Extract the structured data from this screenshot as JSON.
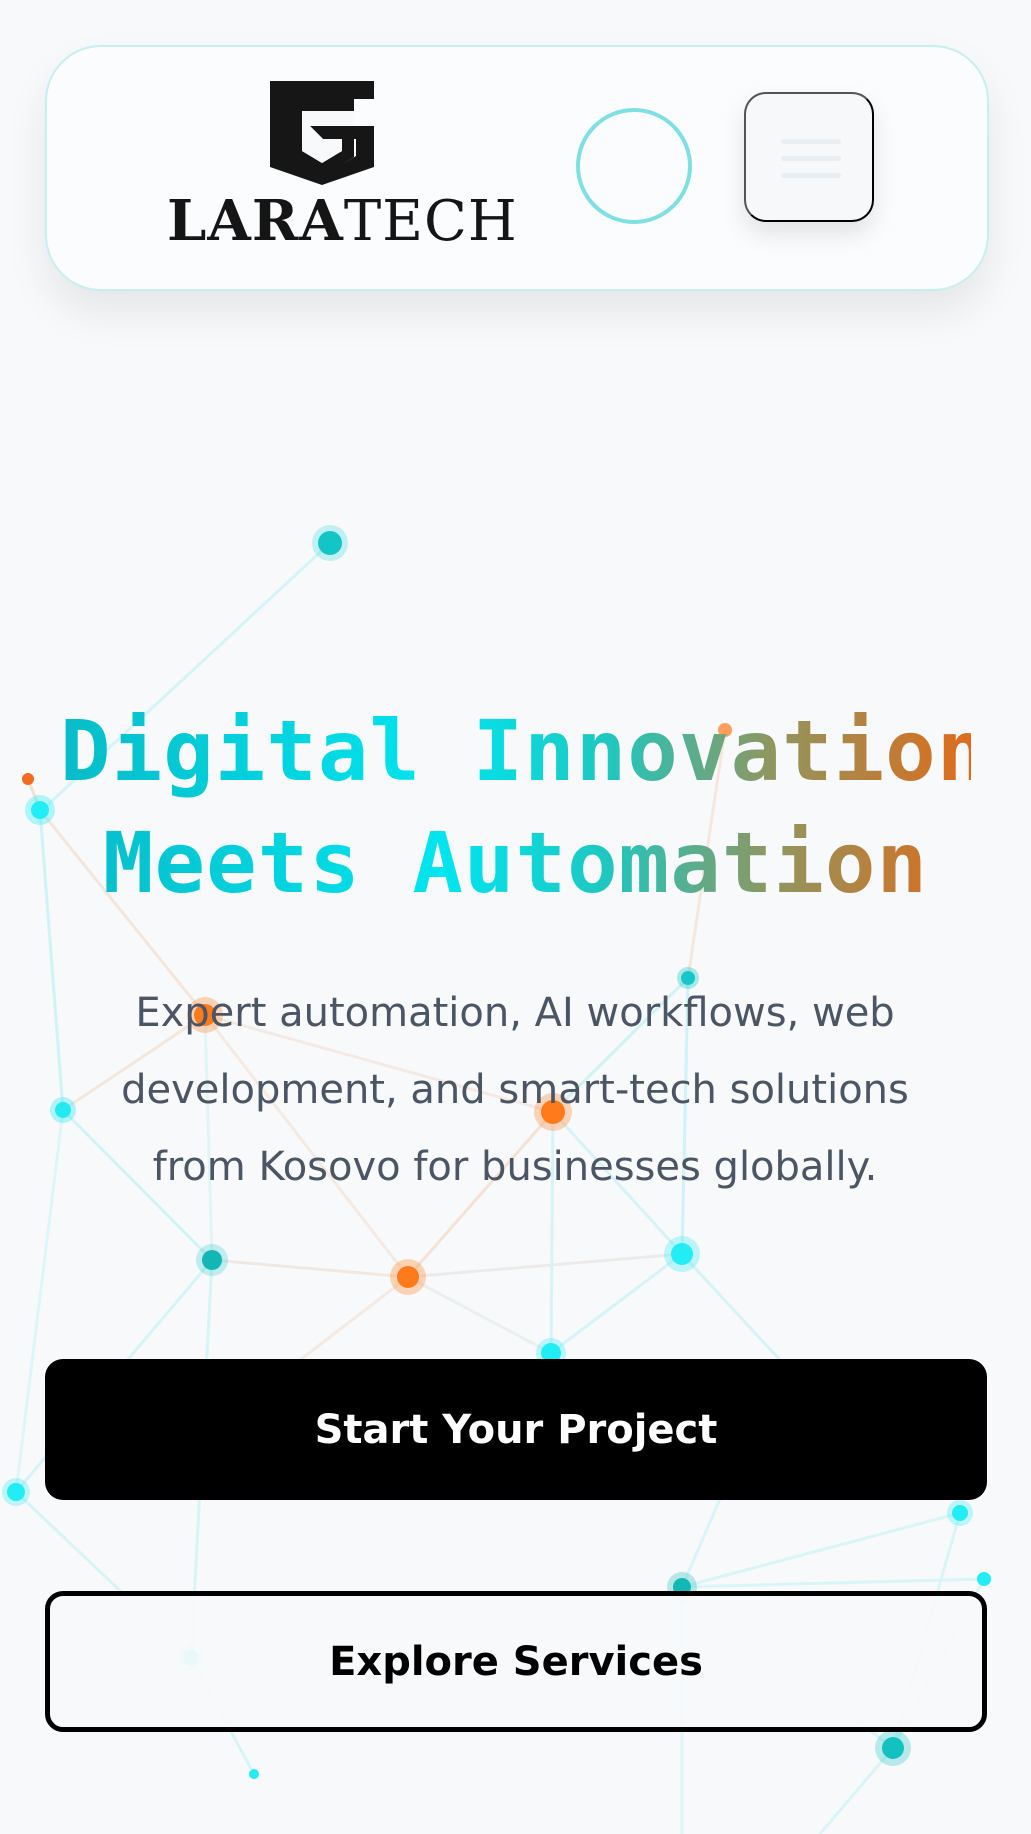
{
  "header": {
    "logo": {
      "word_bold": "LARA",
      "word_regular": "TECH"
    },
    "theme_toggle_icon": "circle-toggle-icon",
    "menu_icon": "hamburger-icon"
  },
  "hero": {
    "title_line1": "Digital Innovation",
    "title_line2": "Meets Automation",
    "subtitle": "Expert automation, AI workflows, web development, and smart-tech solutions from Kosovo for businesses globally.",
    "primary_cta": "Start Your Project",
    "secondary_cta": "Explore Services"
  },
  "colors": {
    "cyan": "#00e5ef",
    "teal": "#07bcc8",
    "orange": "#df6b1b",
    "background": "#f7f9fb",
    "text": "#4b5563",
    "button_dark": "#000000"
  }
}
